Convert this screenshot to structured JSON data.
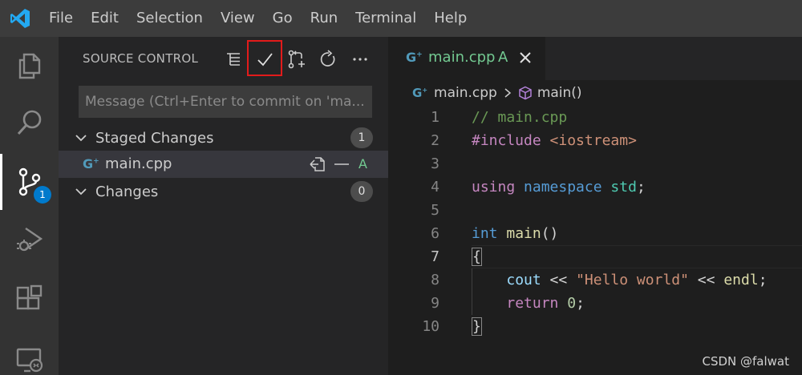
{
  "menu": [
    "File",
    "Edit",
    "Selection",
    "View",
    "Go",
    "Run",
    "Terminal",
    "Help"
  ],
  "activity": {
    "explorer_icon": "files-icon",
    "search_icon": "search-icon",
    "scm_icon": "source-control-icon",
    "scm_badge": "1",
    "debug_icon": "run-debug-icon",
    "extensions_icon": "extensions-icon",
    "remote_icon": "remote-explorer-icon"
  },
  "sidebar": {
    "title": "SOURCE CONTROL",
    "message_placeholder": "Message (Ctrl+Enter to commit on 'ma...",
    "staged": {
      "label": "Staged Changes",
      "count": "1"
    },
    "staged_file": {
      "name": "main.cpp",
      "status": "A"
    },
    "changes": {
      "label": "Changes",
      "count": "0"
    }
  },
  "editor": {
    "tab": {
      "name": "main.cpp",
      "status": "A"
    },
    "breadcrumb": {
      "file": "main.cpp",
      "symbol": "main()"
    },
    "current_line": 7,
    "lines": [
      {
        "n": "1",
        "tokens": [
          [
            "c-comment",
            "// main.cpp"
          ]
        ]
      },
      {
        "n": "2",
        "tokens": [
          [
            "c-pre",
            "#include"
          ],
          [
            "c-plain",
            " "
          ],
          [
            "c-inc",
            "<iostream>"
          ]
        ]
      },
      {
        "n": "3",
        "tokens": []
      },
      {
        "n": "4",
        "tokens": [
          [
            "c-kw2",
            "using"
          ],
          [
            "c-plain",
            " "
          ],
          [
            "c-kw",
            "namespace"
          ],
          [
            "c-plain",
            " "
          ],
          [
            "c-type",
            "std"
          ],
          [
            "c-plain",
            ";"
          ]
        ]
      },
      {
        "n": "5",
        "tokens": []
      },
      {
        "n": "6",
        "tokens": [
          [
            "c-kw",
            "int"
          ],
          [
            "c-plain",
            " "
          ],
          [
            "c-fn",
            "main"
          ],
          [
            "c-plain",
            "()"
          ]
        ]
      },
      {
        "n": "7",
        "tokens": [
          [
            "c-plain brace",
            "{"
          ]
        ]
      },
      {
        "n": "8",
        "tokens": [
          [
            "c-plain",
            "    "
          ],
          [
            "c-var",
            "cout"
          ],
          [
            "c-plain",
            " << "
          ],
          [
            "c-str",
            "\"Hello world\""
          ],
          [
            "c-plain",
            " << "
          ],
          [
            "c-fn",
            "endl"
          ],
          [
            "c-plain",
            ";"
          ]
        ]
      },
      {
        "n": "9",
        "tokens": [
          [
            "c-plain",
            "    "
          ],
          [
            "c-kw2",
            "return"
          ],
          [
            "c-plain",
            " "
          ],
          [
            "c-num",
            "0"
          ],
          [
            "c-plain",
            ";"
          ]
        ]
      },
      {
        "n": "10",
        "tokens": [
          [
            "c-plain brace",
            "}"
          ]
        ]
      }
    ]
  },
  "watermark": "CSDN @falwat",
  "colors": {
    "accent": "#007acc",
    "added": "#73c991",
    "highlight_box": "#e21b1b"
  }
}
